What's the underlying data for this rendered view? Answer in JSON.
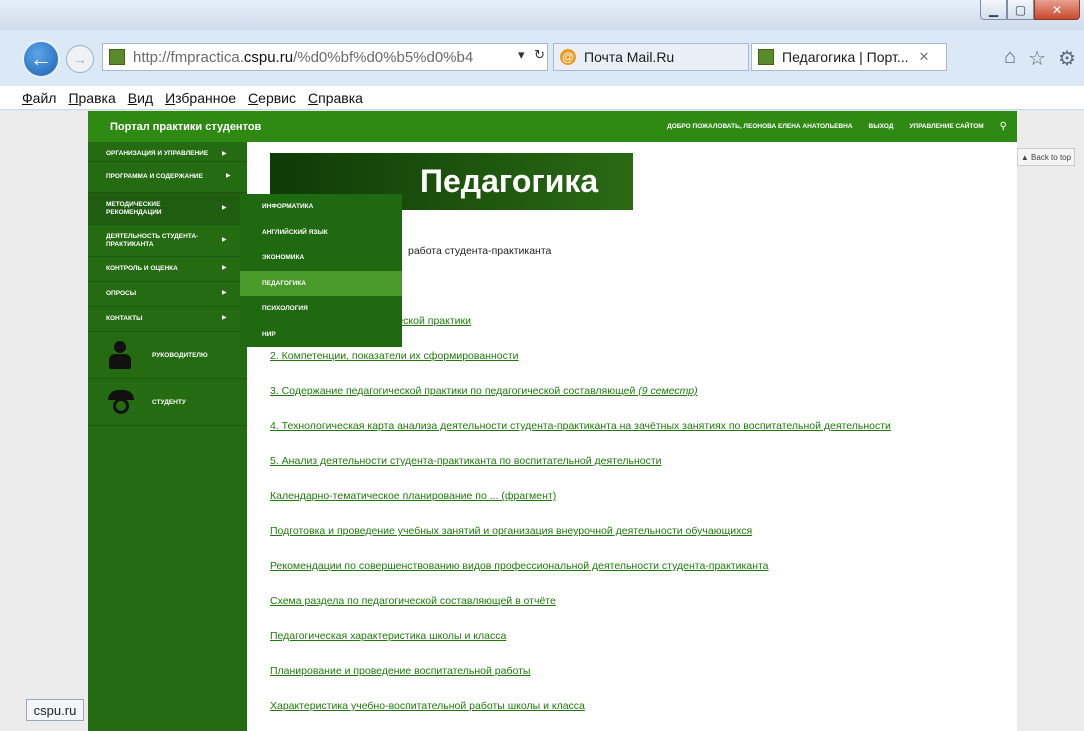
{
  "browser": {
    "address": {
      "prefix": "http://fmpractica.",
      "domain": "cspu.ru",
      "suffix": "/%d0%bf%d0%b5%d0%b4"
    },
    "tabs": [
      {
        "label": "Почта Mail.Ru",
        "icon": "mail-icon"
      },
      {
        "label": "Педагогика | Порт...",
        "icon": "site-icon"
      }
    ],
    "menu": [
      "Файл",
      "Правка",
      "Вид",
      "Избранное",
      "Сервис",
      "Справка"
    ],
    "status_chip": "cspu.ru",
    "back_to_top": "▲ Back to top"
  },
  "site": {
    "title": "Портал практики студентов",
    "top_links": [
      "ДОБРО ПОЖАЛОВАТЬ, ЛЕОНОВА ЕЛЕНА АНАТОЛЬЕВНА",
      "ВЫХОД",
      "УПРАВЛЕНИЕ САЙТОМ"
    ]
  },
  "sidebar": {
    "items": [
      {
        "label": "ОРГАНИЗАЦИЯ И УПРАВЛЕНИЕ"
      },
      {
        "label": "ПРОГРАММА И СОДЕРЖАНИЕ"
      },
      {
        "label": "МЕТОДИЧЕСКИЕ РЕКОМЕНДАЦИИ"
      },
      {
        "label": "ДЕЯТЕЛЬНОСТЬ СТУДЕНТА-ПРАКТИКАНТА"
      },
      {
        "label": "КОНТРОЛЬ И ОЦЕНКА"
      },
      {
        "label": "ОПРОСЫ"
      },
      {
        "label": "КОНТАКТЫ"
      }
    ],
    "roles": [
      {
        "label": "РУКОВОДИТЕЛЮ",
        "icon": "person-icon"
      },
      {
        "label": "СТУДЕНТУ",
        "icon": "student-cap-icon"
      }
    ]
  },
  "submenu": {
    "items": [
      "ИНФОРМАТИКА",
      "АНГЛИЙСКИЙ ЯЗЫК",
      "ЭКОНОМИКА",
      "ПЕДАГОГИКА",
      "ПСИХОЛОГИЯ",
      "НИР"
    ],
    "active": "ПЕДАГОГИКА"
  },
  "main": {
    "heading": "Педагогика",
    "intro": "работа студента-практиканта",
    "links": [
      "ической практики",
      "2. Компетенции, показатели их сформированности",
      "3. Содержание педагогической практики по педагогической составляющей",
      "4. Технологическая карта анализа деятельности студента-практиканта на зачётных занятиях по воспитательной деятельности",
      "5. Анализ деятельности студента-практиканта по воспитательной деятельности",
      "Календарно-тематическое планирование по ... (фрагмент)",
      "Подготовка и проведение учебных занятий и организация внеурочной деятельности обучающихся",
      "Рекомендации по совершенствованию видов профессиональной деятельности студента-практиканта",
      "Схема раздела по педагогической составляющей в отчёте",
      "Педагогическая характеристика школы и класса",
      "Планирование и проведение воспитательной работы",
      "Характеристика учебно-воспитательной работы школы и класса"
    ],
    "link3_italic": "(9 семестр)"
  }
}
